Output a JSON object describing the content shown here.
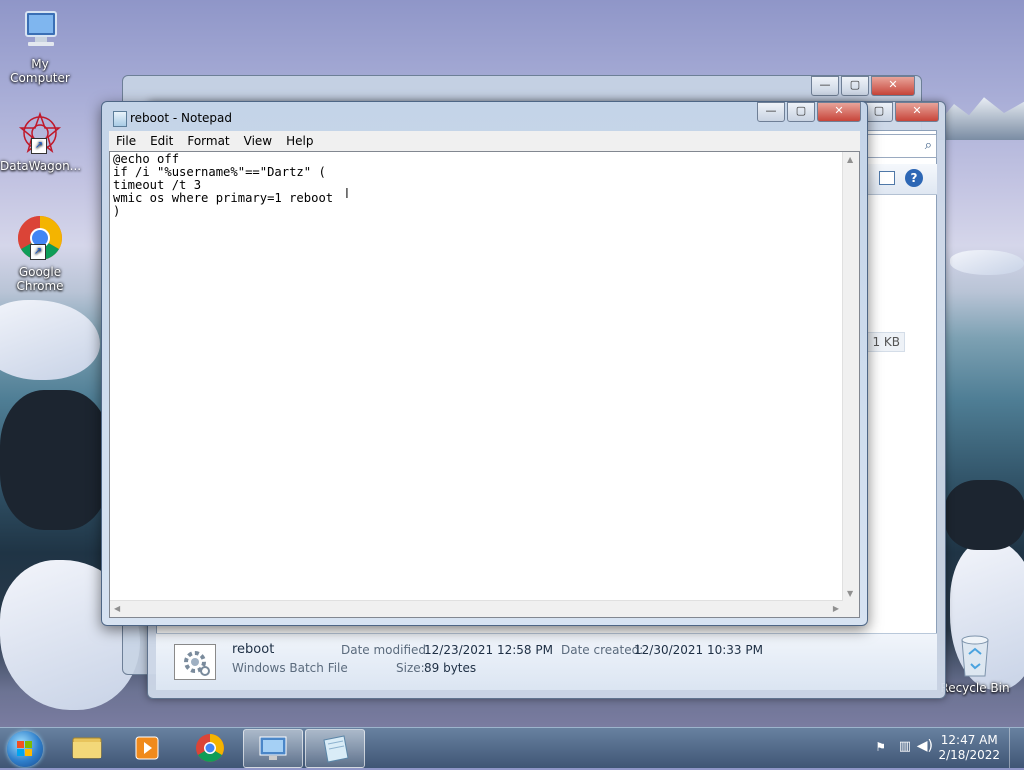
{
  "desktop": {
    "icons": [
      {
        "label": "My Computer"
      },
      {
        "label": "DataWagon..."
      },
      {
        "label": "Google Chrome"
      },
      {
        "label": "Recycle Bin"
      }
    ]
  },
  "explorer": {
    "size_badge": "1 KB",
    "details": {
      "file_name": "reboot",
      "file_type": "Windows Batch File",
      "date_modified_label": "Date modified:",
      "date_modified": "12/23/2021 12:58 PM",
      "date_created_label": "Date created:",
      "date_created": "12/30/2021 10:33 PM",
      "size_label": "Size:",
      "size": "89 bytes"
    }
  },
  "notepad": {
    "title": "reboot - Notepad",
    "menu": [
      "File",
      "Edit",
      "Format",
      "View",
      "Help"
    ],
    "content": "@echo off\nif /i \"%username%\"==\"Dartz\" (\ntimeout /t 3\nwmic os where primary=1 reboot\n)"
  },
  "taskbar": {
    "clock_time": "12:47 AM",
    "clock_date": "2/18/2022"
  },
  "colors": {
    "notepad_frame": "#c4d4e8",
    "close_button": "#c7453a",
    "taskbar": "#375070"
  }
}
